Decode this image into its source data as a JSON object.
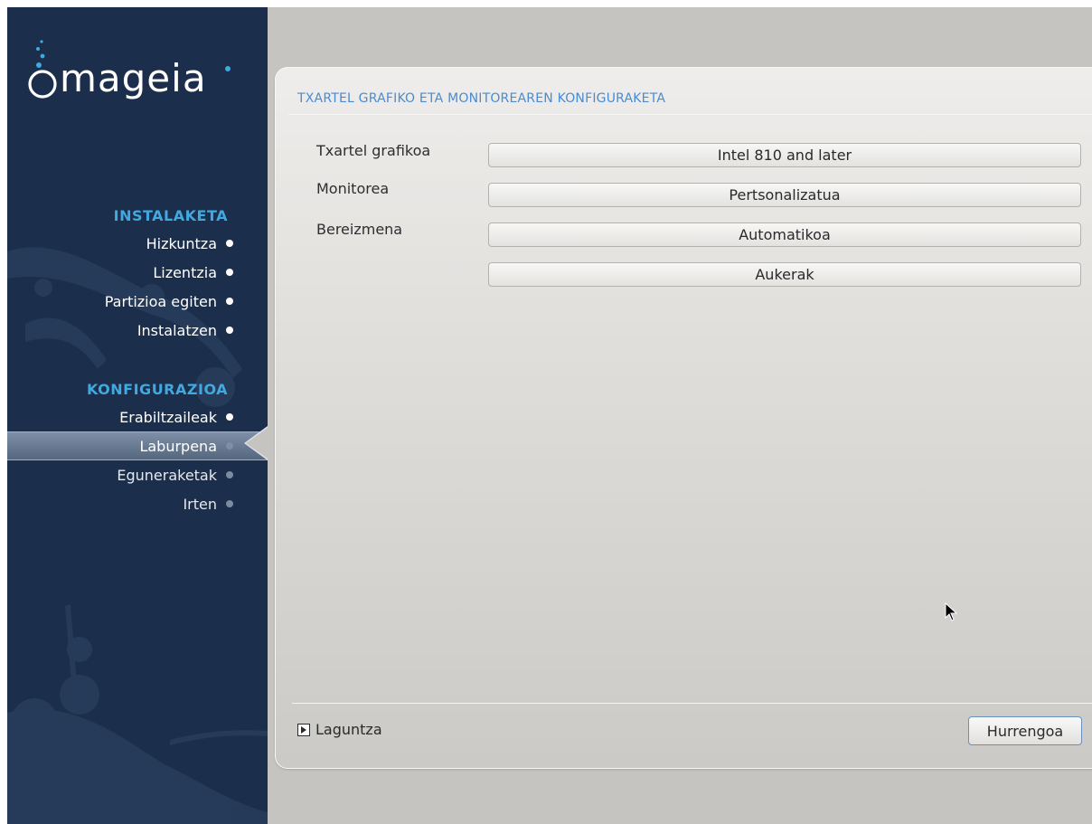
{
  "brand": {
    "logo_text": "mageia"
  },
  "sidebar": {
    "sections": [
      {
        "heading": "INSTALAKETA",
        "items": [
          {
            "label": "Hizkuntza",
            "state": "done"
          },
          {
            "label": "Lizentzia",
            "state": "done"
          },
          {
            "label": "Partizioa egiten",
            "state": "done"
          },
          {
            "label": "Instalatzen",
            "state": "done"
          }
        ]
      },
      {
        "heading": "KONFIGURAZIOA",
        "items": [
          {
            "label": "Erabiltzaileak",
            "state": "done"
          },
          {
            "label": "Laburpena",
            "state": "current"
          },
          {
            "label": "Eguneraketak",
            "state": "pending"
          },
          {
            "label": "Irten",
            "state": "pending"
          }
        ]
      }
    ]
  },
  "main": {
    "title": "TXARTEL GRAFIKO ETA MONITOREAREN KONFIGURAKETA",
    "rows": [
      {
        "label": "Txartel grafikoa",
        "value": "Intel 810 and later"
      },
      {
        "label": "Monitorea",
        "value": "Pertsonalizatua"
      },
      {
        "label": "Bereizmena",
        "value": "Automatikoa"
      }
    ],
    "options_button": "Aukerak"
  },
  "footer": {
    "help_label": "Laguntza",
    "next_label": "Hurrengoa"
  },
  "colors": {
    "sidebar_bg": "#1b2e4b",
    "section_heading": "#3fa9e0",
    "title": "#4a8bd2",
    "desktop_bg": "#c5c4c0"
  },
  "icons": [
    "mageia-logo-icon",
    "bullet-dot-icon",
    "current-step-arrow-icon",
    "expand-triangle-icon",
    "mouse-pointer-icon"
  ]
}
